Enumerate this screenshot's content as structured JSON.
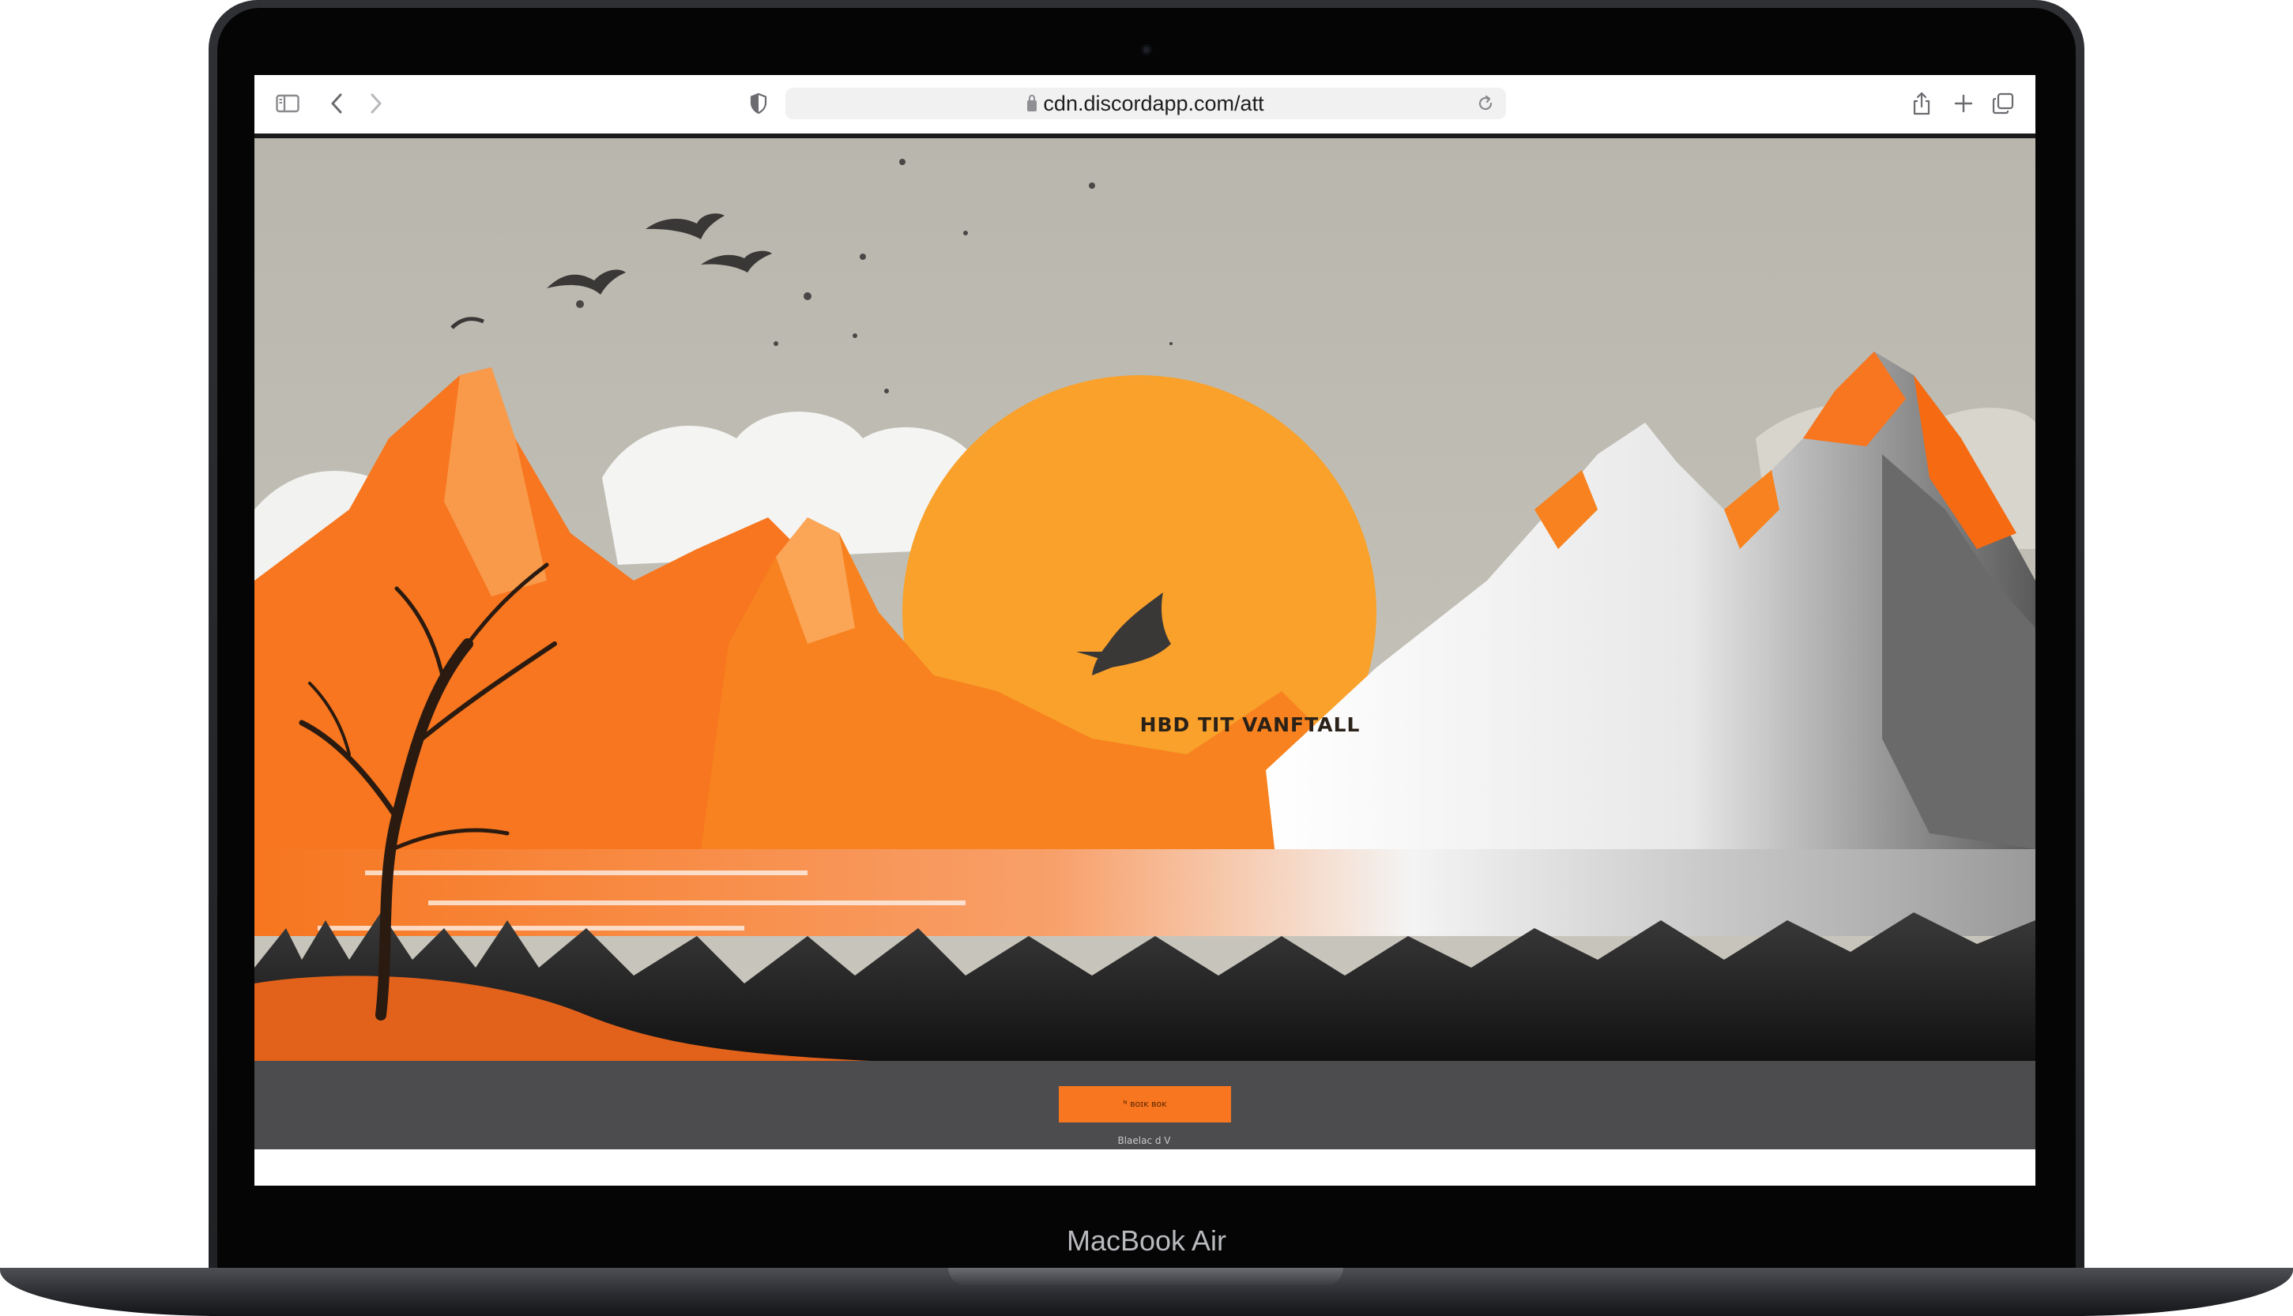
{
  "browser": {
    "url": "cdn.discordapp.com/att",
    "icons": [
      "sidebar-icon",
      "back-icon",
      "forward-icon",
      "shield-icon",
      "lock-icon",
      "reload-icon",
      "share-icon",
      "new-tab-icon",
      "tabs-overview-icon"
    ]
  },
  "page": {
    "hero_title": "HBD TIT VANFTALL",
    "button_label": "ᴺ ʙᴏɪᴋ ʙᴏᴋ",
    "caption": "Blaelac d V"
  },
  "device": {
    "label": "MacBook Air"
  },
  "colors": {
    "accent_orange": "#f7761f",
    "sun_orange": "#f9a12b",
    "sky_gray": "#c2c0b5",
    "band_gray": "#4c4c4e"
  }
}
